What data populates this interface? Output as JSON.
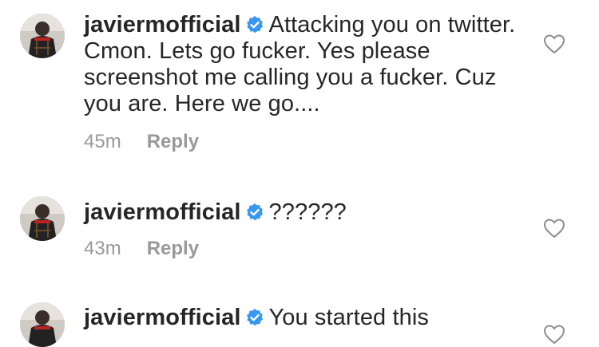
{
  "comments": [
    {
      "username": "javiermofficial",
      "verified": true,
      "text": "Attacking you on twitter. Cmon. Lets go fucker. Yes please screenshot me calling you a fucker. Cuz you are. Here we go....",
      "time": "45m",
      "reply_label": "Reply",
      "icons": {
        "avatar": "profile-photo",
        "verified": "verified-badge-icon",
        "like": "heart-outline-icon"
      }
    },
    {
      "username": "javiermofficial",
      "verified": true,
      "text": "??????",
      "time": "43m",
      "reply_label": "Reply",
      "icons": {
        "avatar": "profile-photo",
        "verified": "verified-badge-icon",
        "like": "heart-outline-icon"
      }
    },
    {
      "username": "javiermofficial",
      "verified": true,
      "text": "You started this",
      "icons": {
        "avatar": "profile-photo",
        "verified": "verified-badge-icon",
        "like": "heart-outline-icon"
      }
    }
  ],
  "colors": {
    "text": "#262626",
    "meta": "#999999",
    "verified_badge": "#3897f0",
    "heart_stroke": "#8e8e8e"
  }
}
